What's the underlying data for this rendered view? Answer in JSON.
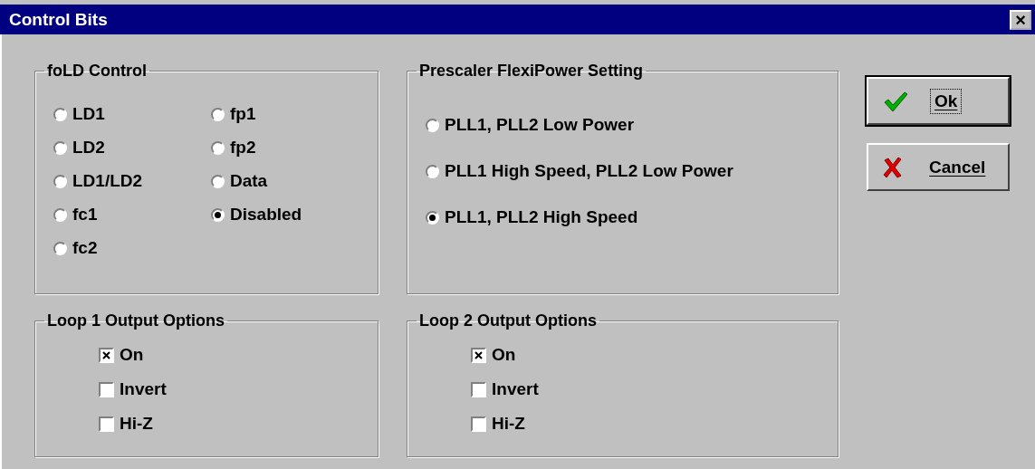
{
  "window": {
    "title": "Control Bits",
    "close": "×"
  },
  "fold_control": {
    "title": "foLD Control",
    "options": [
      {
        "label": "LD1",
        "selected": false
      },
      {
        "label": "LD2",
        "selected": false
      },
      {
        "label": "LD1/LD2",
        "selected": false
      },
      {
        "label": "fc1",
        "selected": false
      },
      {
        "label": "fc2",
        "selected": false
      },
      {
        "label": "fp1",
        "selected": false
      },
      {
        "label": "fp2",
        "selected": false
      },
      {
        "label": "Data",
        "selected": false
      },
      {
        "label": "Disabled",
        "selected": true
      }
    ]
  },
  "prescaler": {
    "title": "Prescaler FlexiPower Setting",
    "options": [
      {
        "label": "PLL1, PLL2 Low Power",
        "selected": false
      },
      {
        "label": "PLL1 High Speed, PLL2 Low Power",
        "selected": false
      },
      {
        "label": "PLL1, PLL2 High Speed",
        "selected": true
      }
    ]
  },
  "loop_options": [
    {
      "title": "Loop 1 Output Options",
      "options": [
        {
          "label": "On",
          "checked": true
        },
        {
          "label": "Invert",
          "checked": false
        },
        {
          "label": "Hi-Z",
          "checked": false
        }
      ]
    },
    {
      "title": "Loop 2 Output Options",
      "options": [
        {
          "label": "On",
          "checked": true
        },
        {
          "label": "Invert",
          "checked": false
        },
        {
          "label": "Hi-Z",
          "checked": false
        }
      ]
    }
  ],
  "buttons": [
    {
      "kind": "ok",
      "label": "Ok",
      "default": true
    },
    {
      "kind": "cancel",
      "label": "Cancel",
      "default": false
    }
  ]
}
